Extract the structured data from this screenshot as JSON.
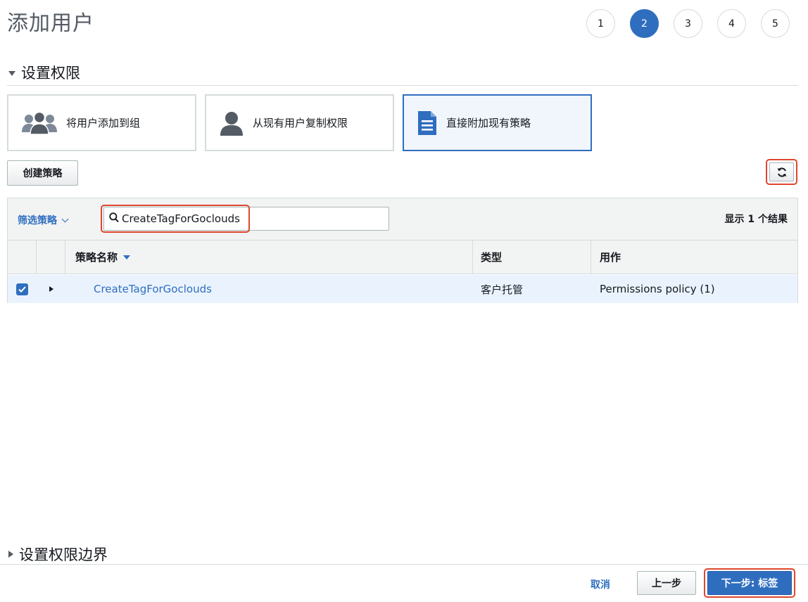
{
  "page": {
    "title": "添加用户"
  },
  "steps": [
    {
      "label": "1",
      "active": false
    },
    {
      "label": "2",
      "active": true
    },
    {
      "label": "3",
      "active": false
    },
    {
      "label": "4",
      "active": false
    },
    {
      "label": "5",
      "active": false
    }
  ],
  "permissions": {
    "header": "设置权限",
    "options": [
      {
        "label": "将用户添加到组",
        "icon": "users-group-icon",
        "selected": false
      },
      {
        "label": "从现有用户复制权限",
        "icon": "user-icon",
        "selected": false
      },
      {
        "label": "直接附加现有策略",
        "icon": "document-icon",
        "selected": true
      }
    ],
    "create_policy_label": "创建策略"
  },
  "filter": {
    "label": "筛选策略",
    "search_value": "CreateTagForGoclouds",
    "result_count": "显示 1 个结果"
  },
  "table": {
    "headers": {
      "name": "策略名称",
      "type": "类型",
      "usage": "用作"
    },
    "rows": [
      {
        "checked": true,
        "name": "CreateTagForGoclouds",
        "type": "客户托管",
        "usage": "Permissions policy (1)"
      }
    ]
  },
  "boundary": {
    "header": "设置权限边界"
  },
  "footer": {
    "cancel_label": "取消",
    "prev_label": "上一步",
    "next_label": "下一步: 标签"
  },
  "colors": {
    "accent": "#2f6ebf",
    "highlight": "#e0452e"
  }
}
